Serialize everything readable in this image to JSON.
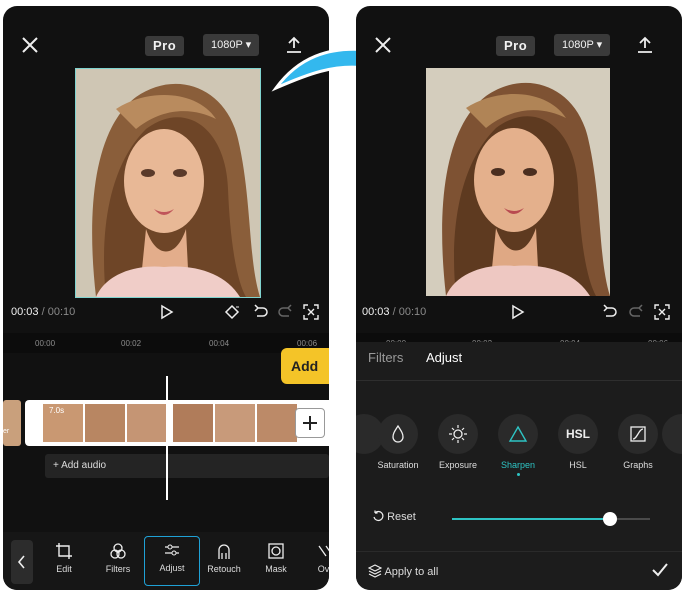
{
  "left": {
    "pro_label": "Pro",
    "resolution": "1080P",
    "time_current": "00:03",
    "time_total": "00:10",
    "ruler": [
      "00:00",
      "00:02",
      "00:04",
      "00:06"
    ],
    "add_label": "Add",
    "duration_tag": "7.0s",
    "left_clip_label": "er",
    "add_audio": "+ Add audio",
    "tools": [
      "Edit",
      "Filters",
      "Adjust",
      "Retouch",
      "Mask",
      "Ove"
    ],
    "active_tool": "Adjust"
  },
  "right": {
    "pro_label": "Pro",
    "resolution": "1080P",
    "time_current": "00:03",
    "time_total": "00:10",
    "ruler": [
      "00:00",
      "00:02",
      "00:04",
      "00:06"
    ],
    "tabs": {
      "filters": "Filters",
      "adjust": "Adjust"
    },
    "adjust_items": [
      "Saturation",
      "Exposure",
      "Sharpen",
      "HSL",
      "Graphs"
    ],
    "selected_item": "Sharpen",
    "hsl_icon_text": "HSL",
    "reset_label": "Reset",
    "slider_value": 0.8,
    "apply_all": "Apply to all"
  },
  "colors": {
    "accent": "#2ec4c4",
    "add_button": "#f4c428",
    "active_border": "#1fa1d6",
    "arrow": "#33b8ee"
  }
}
